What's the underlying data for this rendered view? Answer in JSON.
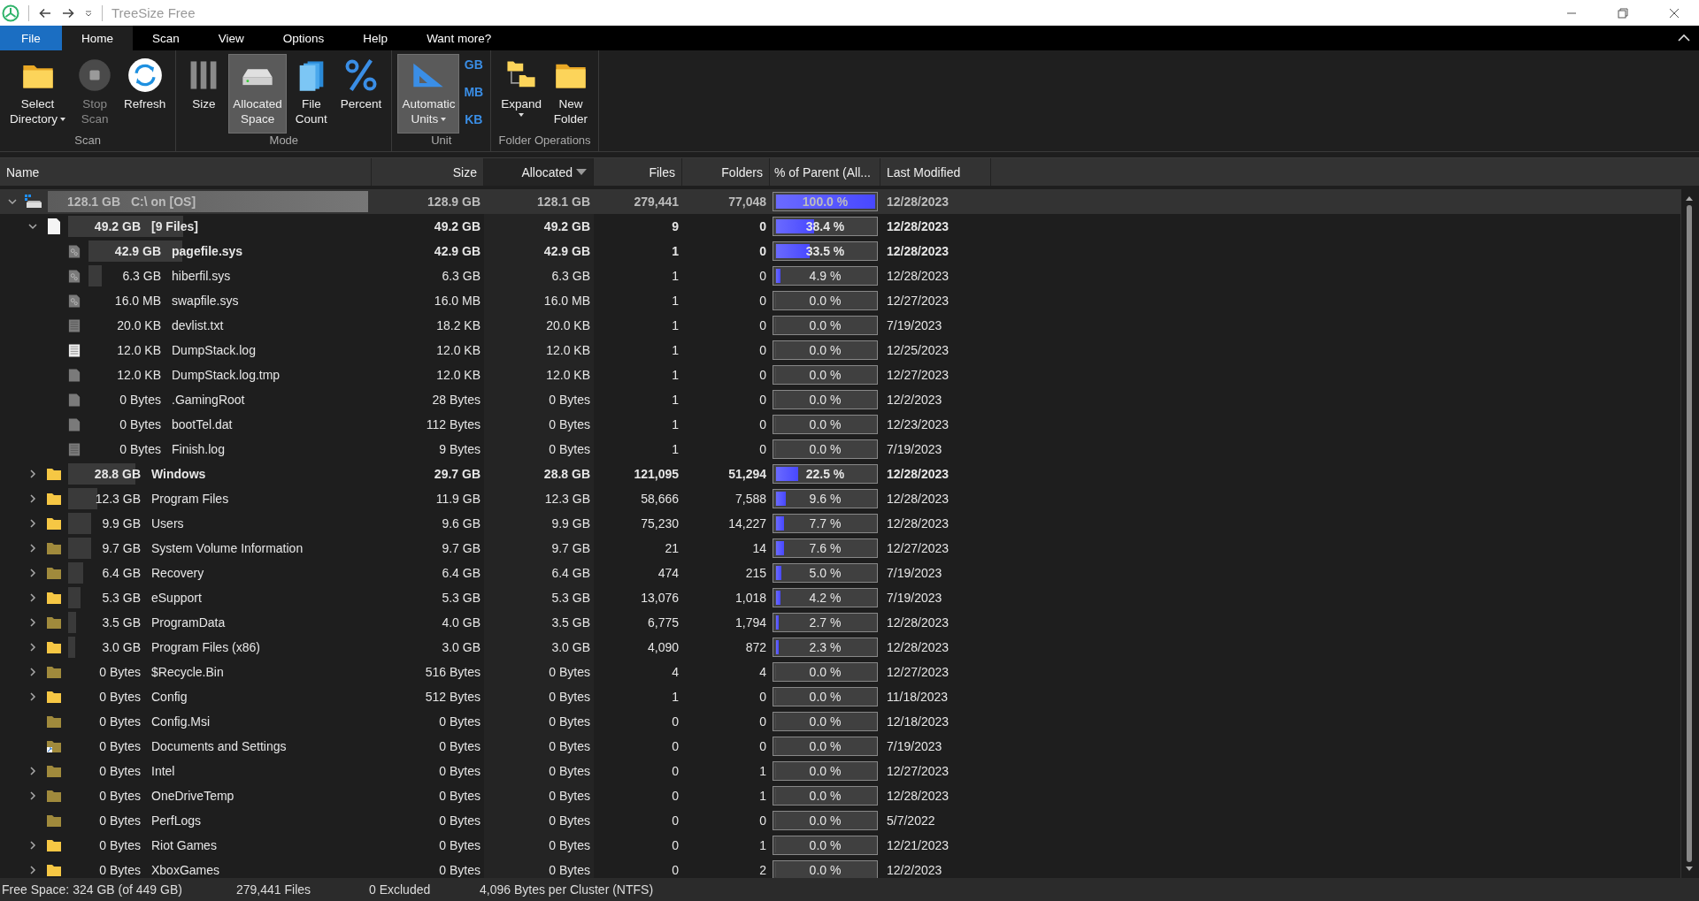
{
  "title_bar": {
    "title": "TreeSize Free"
  },
  "ribbon": {
    "tabs": [
      {
        "label": "File",
        "kind": "backstage",
        "selected": false
      },
      {
        "label": "Home",
        "kind": "tab",
        "selected": true
      },
      {
        "label": "Scan",
        "kind": "tab",
        "selected": false
      },
      {
        "label": "View",
        "kind": "tab",
        "selected": false
      },
      {
        "label": "Options",
        "kind": "tab",
        "selected": false
      },
      {
        "label": "Help",
        "kind": "tab",
        "selected": false
      },
      {
        "label": "Want more?",
        "kind": "tab",
        "selected": false
      }
    ],
    "groups": [
      {
        "label": "Scan",
        "buttons": [
          {
            "kind": "folder",
            "lines": [
              "Select",
              "Directory"
            ],
            "dropdown": true,
            "selected": false,
            "disabled": false
          },
          {
            "kind": "stop",
            "lines": [
              "Stop",
              "Scan"
            ],
            "dropdown": false,
            "selected": false,
            "disabled": true
          },
          {
            "kind": "refresh",
            "lines": [
              "Refresh"
            ],
            "dropdown": false,
            "selected": false,
            "disabled": false
          }
        ]
      },
      {
        "label": "Mode",
        "buttons": [
          {
            "kind": "bars",
            "lines": [
              "Size"
            ],
            "dropdown": false,
            "selected": false,
            "disabled": false
          },
          {
            "kind": "drive",
            "lines": [
              "Allocated",
              "Space"
            ],
            "dropdown": false,
            "selected": true,
            "disabled": false
          },
          {
            "kind": "files",
            "lines": [
              "File",
              "Count"
            ],
            "dropdown": false,
            "selected": false,
            "disabled": false
          },
          {
            "kind": "percent",
            "lines": [
              "Percent"
            ],
            "dropdown": false,
            "selected": false,
            "disabled": false
          }
        ]
      },
      {
        "label": "Unit",
        "buttons": [
          {
            "kind": "ruler",
            "lines": [
              "Automatic",
              "Units"
            ],
            "dropdown": true,
            "selected": true,
            "disabled": false
          }
        ],
        "units": [
          "GB",
          "MB",
          "KB"
        ]
      },
      {
        "label": "Folder Operations",
        "buttons": [
          {
            "kind": "expand",
            "lines": [
              "Expand"
            ],
            "dropdown": true,
            "selected": false,
            "disabled": false
          },
          {
            "kind": "new-folder",
            "lines": [
              "New",
              "Folder"
            ],
            "dropdown": false,
            "selected": false,
            "disabled": false
          }
        ]
      }
    ]
  },
  "table": {
    "columns": [
      {
        "label": "Name",
        "sorted": false
      },
      {
        "label": "Size",
        "sorted": false
      },
      {
        "label": "Allocated",
        "sorted": true
      },
      {
        "label": "Files",
        "sorted": false
      },
      {
        "label": "Folders",
        "sorted": false
      },
      {
        "label": "% of Parent (All...",
        "sorted": false
      },
      {
        "label": "Last Modified",
        "sorted": false
      }
    ],
    "rows": [
      {
        "kind": "drive",
        "size_label": "128.1 GB",
        "name": "C:\\  on  [OS]",
        "size": "128.9 GB",
        "allocated": "128.1 GB",
        "files": "279,441",
        "folders": "77,048",
        "percent": "100.0 %",
        "level": 1.0,
        "modified": "12/28/2023",
        "bold": true,
        "selected": true,
        "expanded": true,
        "children": [
          {
            "kind": "files",
            "size_label": "49.2 GB",
            "name": "[9 Files]",
            "size": "49.2 GB",
            "allocated": "49.2 GB",
            "files": "9",
            "folders": "0",
            "percent": "38.4 %",
            "level": 0.384,
            "modified": "12/28/2023",
            "bold": true,
            "selected": false,
            "expanded": true,
            "children": [
              {
                "kind": "system-file",
                "size_label": "42.9 GB",
                "name": "pagefile.sys",
                "size": "42.9 GB",
                "allocated": "42.9 GB",
                "files": "1",
                "folders": "0",
                "percent": "33.5 %",
                "level": 0.335,
                "modified": "12/28/2023",
                "bold": true,
                "selected": false
              },
              {
                "kind": "system-file",
                "size_label": "6.3 GB",
                "name": "hiberfil.sys",
                "size": "6.3 GB",
                "allocated": "6.3 GB",
                "files": "1",
                "folders": "0",
                "percent": "4.9 %",
                "level": 0.049,
                "modified": "12/28/2023",
                "bold": false,
                "selected": false
              },
              {
                "kind": "system-file",
                "size_label": "16.0 MB",
                "name": "swapfile.sys",
                "size": "16.0 MB",
                "allocated": "16.0 MB",
                "files": "1",
                "folders": "0",
                "percent": "0.0 %",
                "level": 0,
                "modified": "12/27/2023",
                "bold": false,
                "selected": false
              },
              {
                "kind": "text-file",
                "size_label": "20.0 KB",
                "name": "devlist.txt",
                "size": "18.2 KB",
                "allocated": "20.0 KB",
                "files": "1",
                "folders": "0",
                "percent": "0.0 %",
                "level": 0,
                "modified": "7/19/2023",
                "bold": false,
                "selected": false
              },
              {
                "kind": "log-file",
                "size_label": "12.0 KB",
                "name": "DumpStack.log",
                "size": "12.0 KB",
                "allocated": "12.0 KB",
                "files": "1",
                "folders": "0",
                "percent": "0.0 %",
                "level": 0,
                "modified": "12/25/2023",
                "bold": false,
                "selected": false
              },
              {
                "kind": "file",
                "size_label": "12.0 KB",
                "name": "DumpStack.log.tmp",
                "size": "12.0 KB",
                "allocated": "12.0 KB",
                "files": "1",
                "folders": "0",
                "percent": "0.0 %",
                "level": 0,
                "modified": "12/27/2023",
                "bold": false,
                "selected": false
              },
              {
                "kind": "file",
                "size_label": "0 Bytes",
                "name": ".GamingRoot",
                "size": "28 Bytes",
                "allocated": "0 Bytes",
                "files": "1",
                "folders": "0",
                "percent": "0.0 %",
                "level": 0,
                "modified": "12/2/2023",
                "bold": false,
                "selected": false
              },
              {
                "kind": "file",
                "size_label": "0 Bytes",
                "name": "bootTel.dat",
                "size": "112 Bytes",
                "allocated": "0 Bytes",
                "files": "1",
                "folders": "0",
                "percent": "0.0 %",
                "level": 0,
                "modified": "12/23/2023",
                "bold": false,
                "selected": false
              },
              {
                "kind": "text-file",
                "size_label": "0 Bytes",
                "name": "Finish.log",
                "size": "9 Bytes",
                "allocated": "0 Bytes",
                "files": "1",
                "folders": "0",
                "percent": "0.0 %",
                "level": 0,
                "modified": "7/19/2023",
                "bold": false,
                "selected": false
              }
            ]
          },
          {
            "kind": "folder",
            "size_label": "28.8 GB",
            "name": "Windows",
            "size": "29.7 GB",
            "allocated": "28.8 GB",
            "files": "121,095",
            "folders": "51,294",
            "percent": "22.5 %",
            "level": 0.225,
            "modified": "12/28/2023",
            "bold": true,
            "selected": false,
            "expanded": false
          },
          {
            "kind": "folder",
            "size_label": "12.3 GB",
            "name": "Program Files",
            "size": "11.9 GB",
            "allocated": "12.3 GB",
            "files": "58,666",
            "folders": "7,588",
            "percent": "9.6 %",
            "level": 0.096,
            "modified": "12/28/2023",
            "bold": false,
            "selected": false,
            "expanded": false
          },
          {
            "kind": "folder",
            "size_label": "9.9 GB",
            "name": "Users",
            "size": "9.6 GB",
            "allocated": "9.9 GB",
            "files": "75,230",
            "folders": "14,227",
            "percent": "7.7 %",
            "level": 0.077,
            "modified": "12/28/2023",
            "bold": false,
            "selected": false,
            "expanded": false
          },
          {
            "kind": "hidden-folder",
            "size_label": "9.7 GB",
            "name": "System Volume Information",
            "size": "9.7 GB",
            "allocated": "9.7 GB",
            "files": "21",
            "folders": "14",
            "percent": "7.6 %",
            "level": 0.076,
            "modified": "12/27/2023",
            "bold": false,
            "selected": false,
            "expanded": false
          },
          {
            "kind": "hidden-folder",
            "size_label": "6.4 GB",
            "name": "Recovery",
            "size": "6.4 GB",
            "allocated": "6.4 GB",
            "files": "474",
            "folders": "215",
            "percent": "5.0 %",
            "level": 0.05,
            "modified": "7/19/2023",
            "bold": false,
            "selected": false,
            "expanded": false
          },
          {
            "kind": "folder",
            "size_label": "5.3 GB",
            "name": "eSupport",
            "size": "5.3 GB",
            "allocated": "5.3 GB",
            "files": "13,076",
            "folders": "1,018",
            "percent": "4.2 %",
            "level": 0.042,
            "modified": "7/19/2023",
            "bold": false,
            "selected": false,
            "expanded": false
          },
          {
            "kind": "hidden-folder",
            "size_label": "3.5 GB",
            "name": "ProgramData",
            "size": "4.0 GB",
            "allocated": "3.5 GB",
            "files": "6,775",
            "folders": "1,794",
            "percent": "2.7 %",
            "level": 0.027,
            "modified": "12/28/2023",
            "bold": false,
            "selected": false,
            "expanded": false
          },
          {
            "kind": "folder",
            "size_label": "3.0 GB",
            "name": "Program Files (x86)",
            "size": "3.0 GB",
            "allocated": "3.0 GB",
            "files": "4,090",
            "folders": "872",
            "percent": "2.3 %",
            "level": 0.023,
            "modified": "12/28/2023",
            "bold": false,
            "selected": false,
            "expanded": false
          },
          {
            "kind": "hidden-folder",
            "size_label": "0 Bytes",
            "name": "$Recycle.Bin",
            "size": "516 Bytes",
            "allocated": "0 Bytes",
            "files": "4",
            "folders": "4",
            "percent": "0.0 %",
            "level": 0,
            "modified": "12/27/2023",
            "bold": false,
            "selected": false,
            "expanded": false
          },
          {
            "kind": "folder",
            "size_label": "0 Bytes",
            "name": "Config",
            "size": "512 Bytes",
            "allocated": "0 Bytes",
            "files": "1",
            "folders": "0",
            "percent": "0.0 %",
            "level": 0,
            "modified": "11/18/2023",
            "bold": false,
            "selected": false,
            "expanded": false
          },
          {
            "kind": "hidden-folder",
            "size_label": "0 Bytes",
            "name": "Config.Msi",
            "size": "0 Bytes",
            "allocated": "0 Bytes",
            "files": "0",
            "folders": "0",
            "percent": "0.0 %",
            "level": 0,
            "modified": "12/18/2023",
            "bold": false,
            "selected": false
          },
          {
            "kind": "shortcut-folder",
            "size_label": "0 Bytes",
            "name": "Documents and Settings",
            "size": "0 Bytes",
            "allocated": "0 Bytes",
            "files": "0",
            "folders": "0",
            "percent": "0.0 %",
            "level": 0,
            "modified": "7/19/2023",
            "bold": false,
            "selected": false
          },
          {
            "kind": "hidden-folder",
            "size_label": "0 Bytes",
            "name": "Intel",
            "size": "0 Bytes",
            "allocated": "0 Bytes",
            "files": "0",
            "folders": "1",
            "percent": "0.0 %",
            "level": 0,
            "modified": "12/27/2023",
            "bold": false,
            "selected": false,
            "expanded": false
          },
          {
            "kind": "hidden-folder",
            "size_label": "0 Bytes",
            "name": "OneDriveTemp",
            "size": "0 Bytes",
            "allocated": "0 Bytes",
            "files": "0",
            "folders": "1",
            "percent": "0.0 %",
            "level": 0,
            "modified": "12/28/2023",
            "bold": false,
            "selected": false,
            "expanded": false
          },
          {
            "kind": "hidden-folder",
            "size_label": "0 Bytes",
            "name": "PerfLogs",
            "size": "0 Bytes",
            "allocated": "0 Bytes",
            "files": "0",
            "folders": "0",
            "percent": "0.0 %",
            "level": 0,
            "modified": "5/7/2022",
            "bold": false,
            "selected": false
          },
          {
            "kind": "folder",
            "size_label": "0 Bytes",
            "name": "Riot Games",
            "size": "0 Bytes",
            "allocated": "0 Bytes",
            "files": "0",
            "folders": "1",
            "percent": "0.0 %",
            "level": 0,
            "modified": "12/21/2023",
            "bold": false,
            "selected": false,
            "expanded": false
          },
          {
            "kind": "folder",
            "size_label": "0 Bytes",
            "name": "XboxGames",
            "size": "0 Bytes",
            "allocated": "0 Bytes",
            "files": "0",
            "folders": "2",
            "percent": "0.0 %",
            "level": 0,
            "modified": "12/2/2023",
            "bold": false,
            "selected": false,
            "expanded": false
          }
        ]
      }
    ]
  },
  "status_bar": [
    "Free Space: 324 GB  (of 449 GB)",
    "279,441 Files",
    "0 Excluded",
    "4,096 Bytes per Cluster (NTFS)"
  ]
}
